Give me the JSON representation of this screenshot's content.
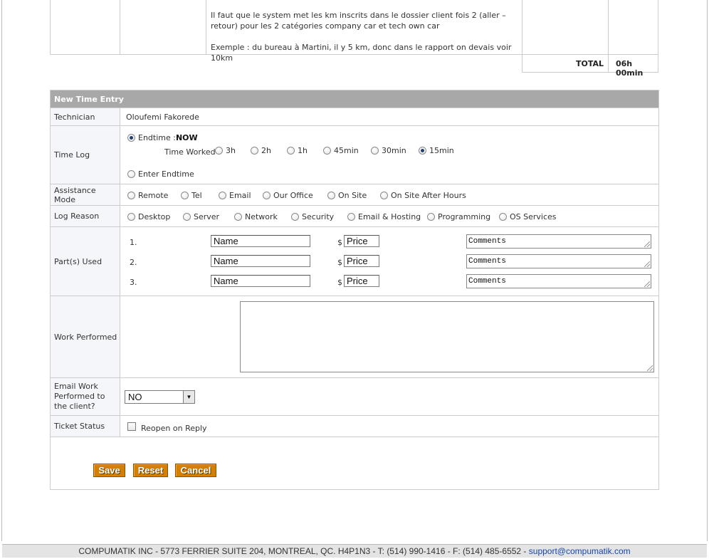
{
  "notes": {
    "line1": "Il faut que le system met les km inscrits dans le dossier client fois 2 (aller – retour) pour les 2 catégories company car et tech own car",
    "line2": "Exemple : du bureau à Martini, il y 5 km, donc dans le rapport on devais voir 10km"
  },
  "total": {
    "label": "TOTAL",
    "value": "06h 00min"
  },
  "form": {
    "title": "New Time Entry",
    "technician": {
      "label": "Technician",
      "value": "Oloufemi Fakorede"
    },
    "time_log": {
      "label": "Time Log",
      "endtime_label": "Endtime : ",
      "endtime_value": "NOW",
      "time_worked_label": "Time Worked",
      "options": [
        "3h",
        "2h",
        "1h",
        "45min",
        "30min",
        "15min"
      ],
      "selected": "15min",
      "enter_endtime": "Enter Endtime"
    },
    "assistance_mode": {
      "label": "Assistance Mode",
      "options": [
        "Remote",
        "Tel",
        "Email",
        "Our Office",
        "On Site",
        "On Site After Hours"
      ]
    },
    "log_reason": {
      "label": "Log Reason",
      "options": [
        "Desktop",
        "Server",
        "Network",
        "Security",
        "Email & Hosting",
        "Programming",
        "OS Services"
      ]
    },
    "parts": {
      "label": "Part(s) Used",
      "currency": "$",
      "rows": [
        {
          "num": "1.",
          "name": "Name",
          "price": "Price",
          "comments": "Comments"
        },
        {
          "num": "2.",
          "name": "Name",
          "price": "Price",
          "comments": "Comments"
        },
        {
          "num": "3.",
          "name": "Name",
          "price": "Price",
          "comments": "Comments"
        }
      ]
    },
    "work_performed": {
      "label": "Work Performed",
      "value": ""
    },
    "email_client": {
      "label": "Email Work Performed to the client?",
      "value": "NO"
    },
    "ticket_status": {
      "label": "Ticket Status",
      "checkbox_label": "Reopen on Reply"
    },
    "buttons": {
      "save": "Save",
      "reset": "Reset",
      "cancel": "Cancel"
    }
  },
  "footer": {
    "text": "COMPUMATIK INC - 5773 FERRIER SUITE 204, MONTREAL, QC. H4P1N3 - T: (514) 990-1416 - F: (514) 485-6552 - ",
    "email": "support@compumatik.com"
  },
  "colors": {
    "header_bg": "#a8a8a8",
    "button_bg": "#d47f00",
    "label_bg": "#f4f6fa",
    "link": "#1a47a8"
  }
}
